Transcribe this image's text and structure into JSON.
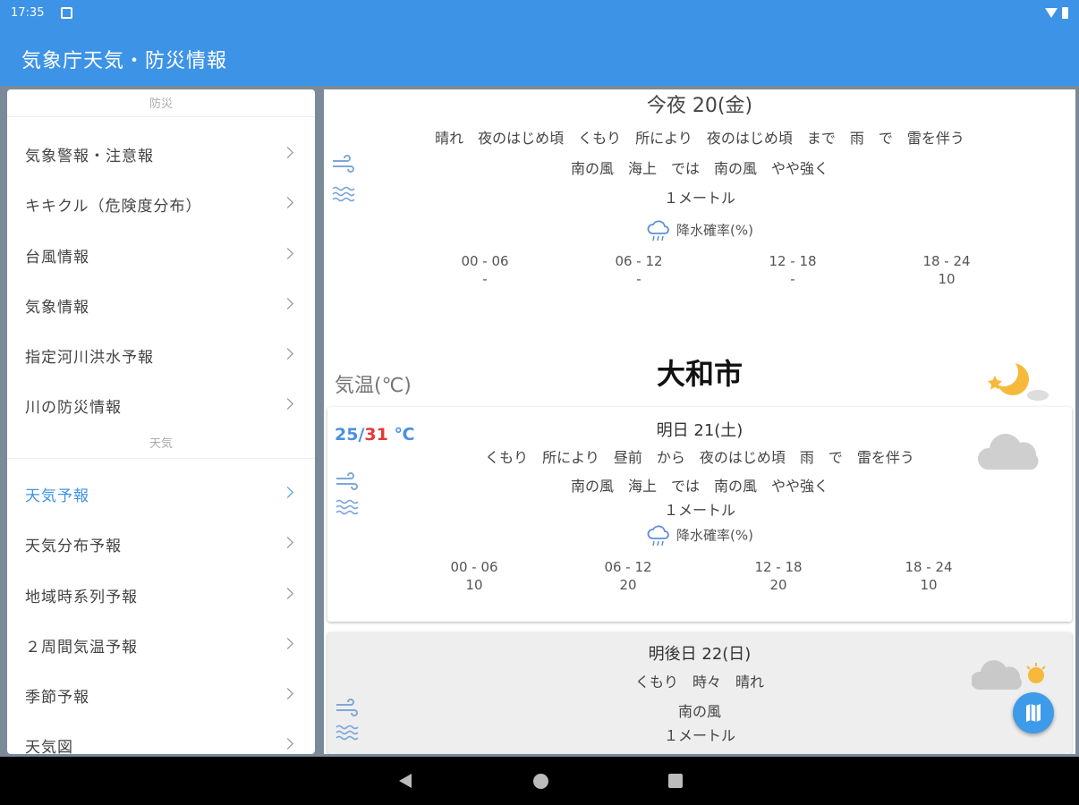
{
  "status_bar": {
    "time": "17:35"
  },
  "app_bar": {
    "title": "気象庁天気・防災情報"
  },
  "sidebar": {
    "sections": [
      {
        "header": "防災",
        "items": [
          "気象警報・注意報",
          "キキクル（危険度分布）",
          "台風情報",
          "気象情報",
          "指定河川洪水予報",
          "川の防災情報"
        ]
      },
      {
        "header": "天気",
        "items": [
          "天気予報",
          "天気分布予報",
          "地域時系列予報",
          "２周間気温予報",
          "季節予報",
          "天気図"
        ]
      }
    ],
    "active_item": "天気予報"
  },
  "tonight": {
    "title": "今夜  20(金)",
    "weather": "晴れ　夜のはじめ頃　くもり　所により　夜のはじめ頃　まで　雨　で　雷を伴う",
    "wind": "南の風　海上　では　南の風　やや強く",
    "wave": "１メートル",
    "precip_label": "降水確率(%)",
    "precip": [
      {
        "period": "00 - 06",
        "value": "-"
      },
      {
        "period": "06 - 12",
        "value": "-"
      },
      {
        "period": "12 - 18",
        "value": "-"
      },
      {
        "period": "18 - 24",
        "value": "10"
      }
    ]
  },
  "city": "大和市",
  "temp_label": "気温(℃)",
  "tomorrow": {
    "title": "明日  21(土)",
    "temp_min": "25",
    "temp_sep": "/",
    "temp_max": "31",
    "temp_unit": " ℃",
    "weather": "くもり　所により　昼前　から　夜のはじめ頃　雨　で　雷を伴う",
    "wind": "南の風　海上　では　南の風　やや強く",
    "wave": "１メートル",
    "precip_label": "降水確率(%)",
    "precip": [
      {
        "period": "00 - 06",
        "value": "10"
      },
      {
        "period": "06 - 12",
        "value": "20"
      },
      {
        "period": "12 - 18",
        "value": "20"
      },
      {
        "period": "18 - 24",
        "value": "10"
      }
    ]
  },
  "day_after": {
    "title": "明後日  22(日)",
    "weather": "くもり　時々　晴れ",
    "wind": "南の風",
    "wave": "１メートル"
  },
  "icons": {
    "wind": "wind-icon",
    "wave": "wave-icon",
    "rain": "rain-cloud-icon",
    "night": "crescent-moon-star-icon",
    "cloudy": "cloud-icon",
    "cloudy_sunny": "cloud-sun-icon",
    "map": "map-icon"
  },
  "colors": {
    "primary": "#3d93e6",
    "temp_min": "#4a90e2",
    "temp_max": "#e53935",
    "fab": "#3d9be9"
  }
}
